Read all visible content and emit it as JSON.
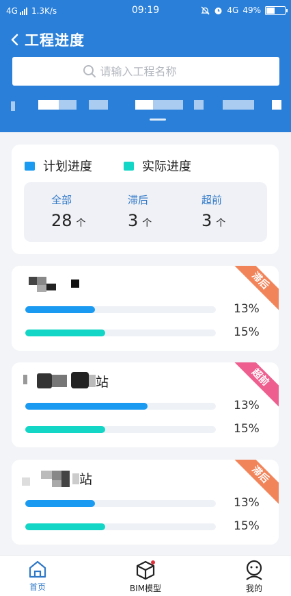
{
  "status_bar": {
    "network": "4G",
    "speed": "1.3K/s",
    "time": "09:19",
    "network2": "4G",
    "battery": "49%",
    "battery_level": 0.49
  },
  "header": {
    "title": "工程进度"
  },
  "search": {
    "placeholder": "请输入工程名称",
    "value": ""
  },
  "legend": {
    "plan": {
      "label": "计划进度",
      "color": "#1a9af0"
    },
    "actual": {
      "label": "实际进度",
      "color": "#14d6c6"
    }
  },
  "summary": {
    "all": {
      "label": "全部",
      "count": "28",
      "unit": "个"
    },
    "behind": {
      "label": "滞后",
      "count": "3",
      "unit": "个"
    },
    "ahead": {
      "label": "超前",
      "count": "3",
      "unit": "个"
    }
  },
  "projects": [
    {
      "badge": "滞后",
      "badge_color": "#f2845a",
      "plan_pct": "13%",
      "actual_pct": "15%",
      "plan_level": 0.13,
      "actual_level": 0.15
    },
    {
      "name_suffix": "站",
      "badge": "超前",
      "badge_color": "#ee5f8f",
      "plan_pct": "13%",
      "actual_pct": "15%",
      "plan_level": 0.13,
      "actual_level": 0.15
    },
    {
      "name_suffix": "站",
      "badge": "滞后",
      "badge_color": "#f2845a",
      "plan_pct": "13%",
      "actual_pct": "15%",
      "plan_level": 0.13,
      "actual_level": 0.15
    }
  ],
  "tabbar": [
    {
      "label": "首页",
      "icon": "home-icon",
      "active": true
    },
    {
      "label": "BIM模型",
      "icon": "cube-icon",
      "active": false
    },
    {
      "label": "我的",
      "icon": "user-icon",
      "active": false
    }
  ]
}
